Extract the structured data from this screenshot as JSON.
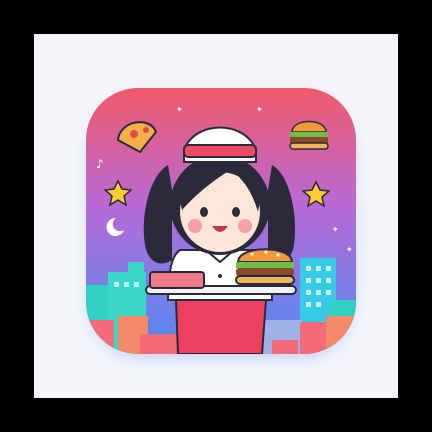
{
  "colors": {
    "frame": "#000000",
    "canvas": "#f3f5fa",
    "sky_top": "#f25a6b",
    "sky_bottom": "#4f8cf3",
    "hair": "#2a2a3b",
    "skin": "#ffe6d8",
    "cap": "#f24b63",
    "pants": "#ef4060",
    "tray": "#d64a5a",
    "burger_bun": "#f29a3a",
    "building_teal": "#2fd1c2",
    "building_coral": "#f46a7a",
    "star": "#ffcc33"
  },
  "icons": [
    "app-icon",
    "pizza-icon",
    "burger-icon",
    "star-icon",
    "moon-icon",
    "music-note-icon",
    "sparkle-icon"
  ]
}
